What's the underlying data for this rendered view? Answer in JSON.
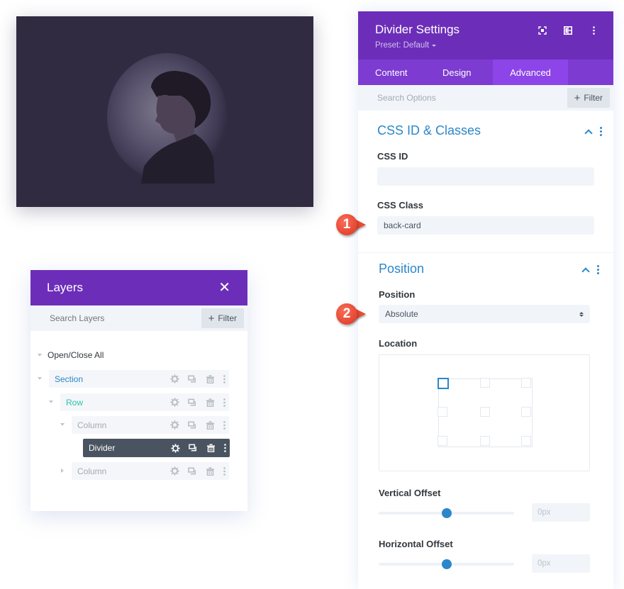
{
  "preview": {
    "description": "Dark purple card with circular vignette portrait of a young man in profile",
    "background_color": "#312b41"
  },
  "layers_panel": {
    "title": "Layers",
    "close_label": "✕",
    "search_placeholder": "Search Layers",
    "filter_label": "Filter",
    "open_close_label": "Open/Close All",
    "items": [
      {
        "label": "Section",
        "color": "#2b87c9",
        "expanded": true,
        "selected": false
      },
      {
        "label": "Row",
        "color": "#29c4a9",
        "expanded": true,
        "selected": false
      },
      {
        "label": "Column",
        "color": "#a3aab3",
        "expanded": true,
        "selected": false
      },
      {
        "label": "Divider",
        "color": "#ffffff",
        "expanded": null,
        "selected": true
      },
      {
        "label": "Column",
        "color": "#a3aab3",
        "expanded": false,
        "selected": false
      }
    ],
    "item_actions": [
      "settings-icon",
      "duplicate-icon",
      "delete-icon",
      "more-icon"
    ]
  },
  "settings_panel": {
    "title": "Divider Settings",
    "preset": "Preset: Default",
    "header_icons": [
      "fullscreen-icon",
      "split-view-icon",
      "more-icon"
    ],
    "tabs": [
      {
        "label": "Content",
        "active": false
      },
      {
        "label": "Design",
        "active": false
      },
      {
        "label": "Advanced",
        "active": true
      }
    ],
    "search_placeholder": "Search Options",
    "filter_label": "Filter",
    "sections": {
      "css": {
        "title": "CSS ID & Classes",
        "css_id_label": "CSS ID",
        "css_id_value": "",
        "css_class_label": "CSS Class",
        "css_class_value": "back-card"
      },
      "position": {
        "title": "Position",
        "position_label": "Position",
        "position_value": "Absolute",
        "location_label": "Location",
        "location_selected": "top-left",
        "vertical_offset_label": "Vertical Offset",
        "vertical_offset_value": "0px",
        "vertical_offset_slider": 0.5,
        "horizontal_offset_label": "Horizontal Offset",
        "horizontal_offset_value": "0px",
        "horizontal_offset_slider": 0.5
      }
    }
  },
  "callouts": [
    {
      "number": "1",
      "target": "css-class-input"
    },
    {
      "number": "2",
      "target": "position-select"
    }
  ],
  "colors": {
    "brand_purple": "#6c2eb9",
    "tab_bar": "#7d3bd1",
    "tab_active": "#8d44e8",
    "accent_blue": "#2b87c9",
    "row_green": "#29c4a9",
    "callout_red": "#e84a35"
  }
}
